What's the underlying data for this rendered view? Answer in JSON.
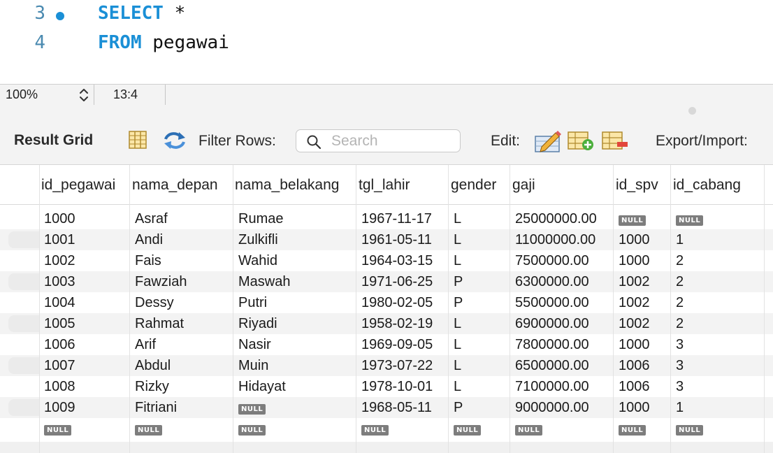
{
  "editor": {
    "lines": [
      {
        "num": "3",
        "kw": "SELECT",
        "rest": " *"
      },
      {
        "num": "4",
        "kw": "FROM",
        "rest": " pegawai"
      }
    ]
  },
  "statusbar": {
    "zoom": "100%",
    "cursor": "13:4"
  },
  "toolbar": {
    "result_grid": "Result Grid",
    "filter_rows": "Filter Rows:",
    "search_placeholder": "Search",
    "edit": "Edit:",
    "export_import": "Export/Import:"
  },
  "grid": {
    "null_text": "NULL",
    "columns": [
      "id_pegawai",
      "nama_depan",
      "nama_belakang",
      "tgl_lahir",
      "gender",
      "gaji",
      "id_spv",
      "id_cabang"
    ],
    "rows": [
      [
        "1000",
        "Asraf",
        "Rumae",
        "1967-11-17",
        "L",
        "25000000.00",
        null,
        null
      ],
      [
        "1001",
        "Andi",
        "Zulkifli",
        "1961-05-11",
        "L",
        "11000000.00",
        "1000",
        "1"
      ],
      [
        "1002",
        "Fais",
        "Wahid",
        "1964-03-15",
        "L",
        "7500000.00",
        "1000",
        "2"
      ],
      [
        "1003",
        "Fawziah",
        "Maswah",
        "1971-06-25",
        "P",
        "6300000.00",
        "1002",
        "2"
      ],
      [
        "1004",
        "Dessy",
        "Putri",
        "1980-02-05",
        "P",
        "5500000.00",
        "1002",
        "2"
      ],
      [
        "1005",
        "Rahmat",
        "Riyadi",
        "1958-02-19",
        "L",
        "6900000.00",
        "1002",
        "2"
      ],
      [
        "1006",
        "Arif",
        "Nasir",
        "1969-09-05",
        "L",
        "7800000.00",
        "1000",
        "3"
      ],
      [
        "1007",
        "Abdul",
        "Muin",
        "1973-07-22",
        "L",
        "6500000.00",
        "1006",
        "3"
      ],
      [
        "1008",
        "Rizky",
        "Hidayat",
        "1978-10-01",
        "L",
        "7100000.00",
        "1006",
        "3"
      ],
      [
        "1009",
        "Fitriani",
        null,
        "1968-05-11",
        "P",
        "9000000.00",
        "1000",
        "1"
      ],
      [
        null,
        null,
        null,
        null,
        null,
        null,
        null,
        null
      ]
    ]
  },
  "colors": {
    "keyword": "#1a8fd6",
    "line_number": "#4a8ab0",
    "null_badge": "#7d7d7d",
    "alt_row": "#f3f3f3"
  }
}
